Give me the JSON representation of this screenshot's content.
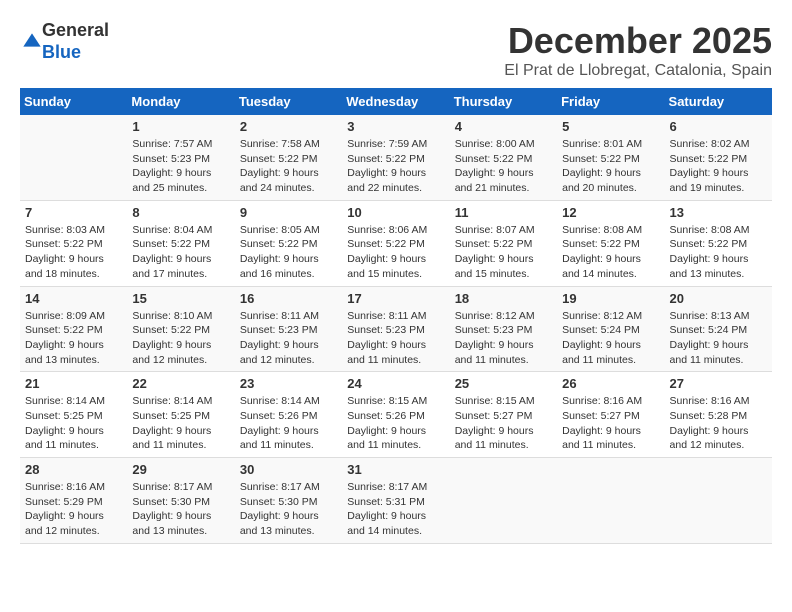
{
  "header": {
    "logo_line1": "General",
    "logo_line2": "Blue",
    "month": "December 2025",
    "location": "El Prat de Llobregat, Catalonia, Spain"
  },
  "days_of_week": [
    "Sunday",
    "Monday",
    "Tuesday",
    "Wednesday",
    "Thursday",
    "Friday",
    "Saturday"
  ],
  "weeks": [
    [
      {
        "num": "",
        "sunrise": "",
        "sunset": "",
        "daylight": ""
      },
      {
        "num": "1",
        "sunrise": "Sunrise: 7:57 AM",
        "sunset": "Sunset: 5:23 PM",
        "daylight": "Daylight: 9 hours and 25 minutes."
      },
      {
        "num": "2",
        "sunrise": "Sunrise: 7:58 AM",
        "sunset": "Sunset: 5:22 PM",
        "daylight": "Daylight: 9 hours and 24 minutes."
      },
      {
        "num": "3",
        "sunrise": "Sunrise: 7:59 AM",
        "sunset": "Sunset: 5:22 PM",
        "daylight": "Daylight: 9 hours and 22 minutes."
      },
      {
        "num": "4",
        "sunrise": "Sunrise: 8:00 AM",
        "sunset": "Sunset: 5:22 PM",
        "daylight": "Daylight: 9 hours and 21 minutes."
      },
      {
        "num": "5",
        "sunrise": "Sunrise: 8:01 AM",
        "sunset": "Sunset: 5:22 PM",
        "daylight": "Daylight: 9 hours and 20 minutes."
      },
      {
        "num": "6",
        "sunrise": "Sunrise: 8:02 AM",
        "sunset": "Sunset: 5:22 PM",
        "daylight": "Daylight: 9 hours and 19 minutes."
      }
    ],
    [
      {
        "num": "7",
        "sunrise": "Sunrise: 8:03 AM",
        "sunset": "Sunset: 5:22 PM",
        "daylight": "Daylight: 9 hours and 18 minutes."
      },
      {
        "num": "8",
        "sunrise": "Sunrise: 8:04 AM",
        "sunset": "Sunset: 5:22 PM",
        "daylight": "Daylight: 9 hours and 17 minutes."
      },
      {
        "num": "9",
        "sunrise": "Sunrise: 8:05 AM",
        "sunset": "Sunset: 5:22 PM",
        "daylight": "Daylight: 9 hours and 16 minutes."
      },
      {
        "num": "10",
        "sunrise": "Sunrise: 8:06 AM",
        "sunset": "Sunset: 5:22 PM",
        "daylight": "Daylight: 9 hours and 15 minutes."
      },
      {
        "num": "11",
        "sunrise": "Sunrise: 8:07 AM",
        "sunset": "Sunset: 5:22 PM",
        "daylight": "Daylight: 9 hours and 15 minutes."
      },
      {
        "num": "12",
        "sunrise": "Sunrise: 8:08 AM",
        "sunset": "Sunset: 5:22 PM",
        "daylight": "Daylight: 9 hours and 14 minutes."
      },
      {
        "num": "13",
        "sunrise": "Sunrise: 8:08 AM",
        "sunset": "Sunset: 5:22 PM",
        "daylight": "Daylight: 9 hours and 13 minutes."
      }
    ],
    [
      {
        "num": "14",
        "sunrise": "Sunrise: 8:09 AM",
        "sunset": "Sunset: 5:22 PM",
        "daylight": "Daylight: 9 hours and 13 minutes."
      },
      {
        "num": "15",
        "sunrise": "Sunrise: 8:10 AM",
        "sunset": "Sunset: 5:22 PM",
        "daylight": "Daylight: 9 hours and 12 minutes."
      },
      {
        "num": "16",
        "sunrise": "Sunrise: 8:11 AM",
        "sunset": "Sunset: 5:23 PM",
        "daylight": "Daylight: 9 hours and 12 minutes."
      },
      {
        "num": "17",
        "sunrise": "Sunrise: 8:11 AM",
        "sunset": "Sunset: 5:23 PM",
        "daylight": "Daylight: 9 hours and 11 minutes."
      },
      {
        "num": "18",
        "sunrise": "Sunrise: 8:12 AM",
        "sunset": "Sunset: 5:23 PM",
        "daylight": "Daylight: 9 hours and 11 minutes."
      },
      {
        "num": "19",
        "sunrise": "Sunrise: 8:12 AM",
        "sunset": "Sunset: 5:24 PM",
        "daylight": "Daylight: 9 hours and 11 minutes."
      },
      {
        "num": "20",
        "sunrise": "Sunrise: 8:13 AM",
        "sunset": "Sunset: 5:24 PM",
        "daylight": "Daylight: 9 hours and 11 minutes."
      }
    ],
    [
      {
        "num": "21",
        "sunrise": "Sunrise: 8:14 AM",
        "sunset": "Sunset: 5:25 PM",
        "daylight": "Daylight: 9 hours and 11 minutes."
      },
      {
        "num": "22",
        "sunrise": "Sunrise: 8:14 AM",
        "sunset": "Sunset: 5:25 PM",
        "daylight": "Daylight: 9 hours and 11 minutes."
      },
      {
        "num": "23",
        "sunrise": "Sunrise: 8:14 AM",
        "sunset": "Sunset: 5:26 PM",
        "daylight": "Daylight: 9 hours and 11 minutes."
      },
      {
        "num": "24",
        "sunrise": "Sunrise: 8:15 AM",
        "sunset": "Sunset: 5:26 PM",
        "daylight": "Daylight: 9 hours and 11 minutes."
      },
      {
        "num": "25",
        "sunrise": "Sunrise: 8:15 AM",
        "sunset": "Sunset: 5:27 PM",
        "daylight": "Daylight: 9 hours and 11 minutes."
      },
      {
        "num": "26",
        "sunrise": "Sunrise: 8:16 AM",
        "sunset": "Sunset: 5:27 PM",
        "daylight": "Daylight: 9 hours and 11 minutes."
      },
      {
        "num": "27",
        "sunrise": "Sunrise: 8:16 AM",
        "sunset": "Sunset: 5:28 PM",
        "daylight": "Daylight: 9 hours and 12 minutes."
      }
    ],
    [
      {
        "num": "28",
        "sunrise": "Sunrise: 8:16 AM",
        "sunset": "Sunset: 5:29 PM",
        "daylight": "Daylight: 9 hours and 12 minutes."
      },
      {
        "num": "29",
        "sunrise": "Sunrise: 8:17 AM",
        "sunset": "Sunset: 5:30 PM",
        "daylight": "Daylight: 9 hours and 13 minutes."
      },
      {
        "num": "30",
        "sunrise": "Sunrise: 8:17 AM",
        "sunset": "Sunset: 5:30 PM",
        "daylight": "Daylight: 9 hours and 13 minutes."
      },
      {
        "num": "31",
        "sunrise": "Sunrise: 8:17 AM",
        "sunset": "Sunset: 5:31 PM",
        "daylight": "Daylight: 9 hours and 14 minutes."
      },
      {
        "num": "",
        "sunrise": "",
        "sunset": "",
        "daylight": ""
      },
      {
        "num": "",
        "sunrise": "",
        "sunset": "",
        "daylight": ""
      },
      {
        "num": "",
        "sunrise": "",
        "sunset": "",
        "daylight": ""
      }
    ]
  ]
}
